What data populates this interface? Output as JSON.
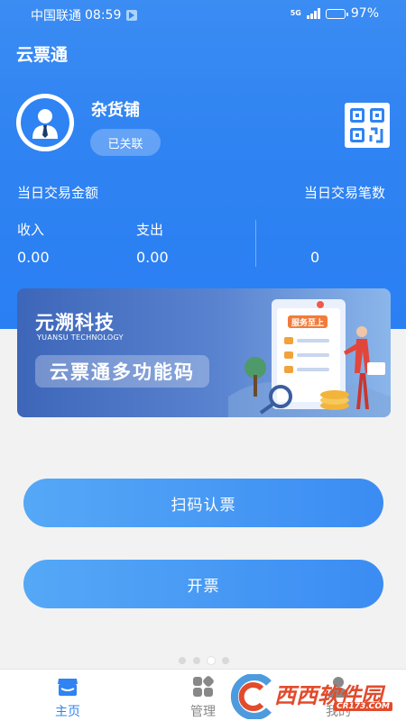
{
  "status": {
    "carrier": "中国联通",
    "time": "08:59",
    "network": "5G",
    "battery": "97%"
  },
  "app": {
    "title": "云票通"
  },
  "profile": {
    "shop_name": "杂货铺",
    "link_status": "已关联",
    "avatar_icon": "user-avatar-icon",
    "qr_icon": "qr-code-icon"
  },
  "stats": {
    "amount_label": "当日交易金额",
    "count_label": "当日交易笔数",
    "income_label": "收入",
    "expense_label": "支出",
    "income_value": "0.00",
    "expense_value": "0.00",
    "count_value": "0"
  },
  "banner": {
    "brand": "元溯科技",
    "brand_en": "YUANSU TECHNOLOGY",
    "headline": "云票通多功能码",
    "sign_text": "服务至上"
  },
  "actions": {
    "scan_label": "扫码认票",
    "invoice_label": "开票"
  },
  "pager": {
    "count": 4,
    "active": 3
  },
  "tabs": [
    {
      "label": "主页",
      "icon": "home-shop-icon",
      "active": true
    },
    {
      "label": "管理",
      "icon": "grid-manage-icon",
      "active": false
    },
    {
      "label": "我的",
      "icon": "profile-icon",
      "active": false
    }
  ],
  "watermark": {
    "text": "西西软件园",
    "url": "CR173.COM"
  },
  "colors": {
    "primary": "#2f83f2",
    "button_start": "#55a8f6",
    "watermark": "#e24b2c"
  }
}
